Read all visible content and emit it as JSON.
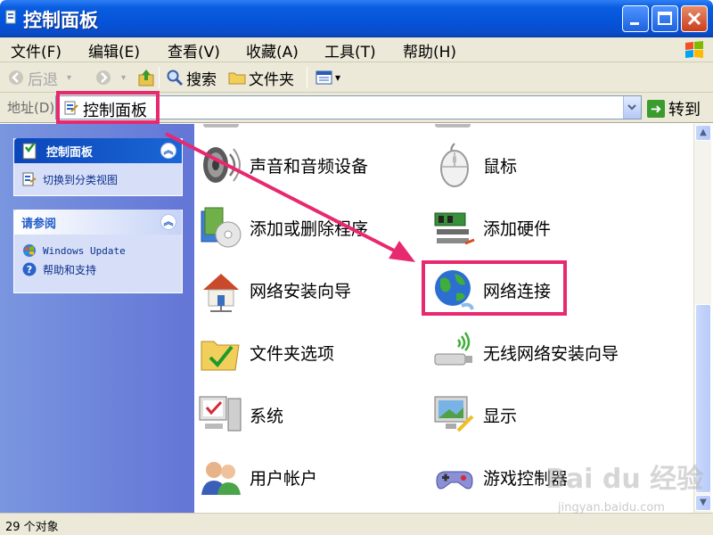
{
  "window": {
    "title": "控制面板",
    "controls": {
      "minimize": "minimize",
      "maximize": "maximize",
      "close": "close"
    }
  },
  "menubar": {
    "items": [
      "文件(F)",
      "编辑(E)",
      "查看(V)",
      "收藏(A)",
      "工具(T)",
      "帮助(H)"
    ]
  },
  "toolbar": {
    "back_label": "后退",
    "search_label": "搜索",
    "folders_label": "文件夹"
  },
  "address": {
    "label": "地址(D)",
    "value": "控制面板",
    "go_label": "转到"
  },
  "sidebar": {
    "control_panel": {
      "title": "控制面板",
      "links": [
        "切换到分类视图"
      ]
    },
    "see_also": {
      "title": "请参阅",
      "links": [
        "Windows Update",
        "帮助和支持"
      ]
    }
  },
  "content": {
    "items": [
      {
        "label": "声音和音频设备",
        "icon": "speaker-icon"
      },
      {
        "label": "鼠标",
        "icon": "mouse-icon"
      },
      {
        "label": "添加或删除程序",
        "icon": "add-remove-programs-icon"
      },
      {
        "label": "添加硬件",
        "icon": "add-hardware-icon"
      },
      {
        "label": "网络安装向导",
        "icon": "network-setup-icon"
      },
      {
        "label": "网络连接",
        "icon": "network-connections-icon"
      },
      {
        "label": "文件夹选项",
        "icon": "folder-options-icon"
      },
      {
        "label": "无线网络安装向导",
        "icon": "wireless-setup-icon"
      },
      {
        "label": "系统",
        "icon": "system-icon"
      },
      {
        "label": "显示",
        "icon": "display-icon"
      },
      {
        "label": "用户帐户",
        "icon": "user-accounts-icon"
      },
      {
        "label": "游戏控制器",
        "icon": "game-controller-icon"
      }
    ]
  },
  "statusbar": {
    "text": "29 个对象"
  },
  "watermark": {
    "text": "Bai du 经验",
    "sub": "jingyan.baidu.com"
  },
  "colors": {
    "highlight": "#e8286f",
    "titlebar": "#0553d8",
    "sidebar": "#6f86da"
  }
}
